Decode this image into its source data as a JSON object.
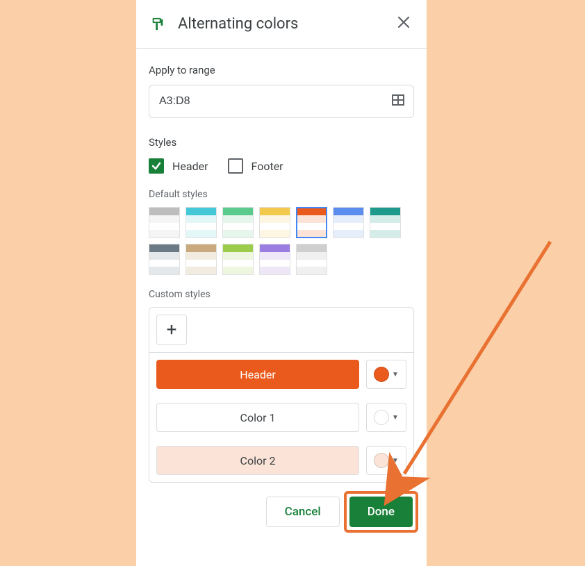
{
  "panel": {
    "title": "Alternating colors"
  },
  "range": {
    "label": "Apply to range",
    "value": "A3:D8"
  },
  "styles": {
    "label": "Styles",
    "header_label": "Header",
    "footer_label": "Footer",
    "header_checked": true,
    "footer_checked": false
  },
  "default_styles": {
    "label": "Default styles",
    "selected_index": 4,
    "swatches": [
      {
        "head": "#bdbdbd",
        "r1": "#f5f5f5",
        "r2": "#ffffff",
        "r3": "#f5f5f5"
      },
      {
        "head": "#44c8d7",
        "r1": "#e3f6f8",
        "r2": "#ffffff",
        "r3": "#e3f6f8"
      },
      {
        "head": "#5bca8d",
        "r1": "#e6f6ed",
        "r2": "#ffffff",
        "r3": "#e6f6ed"
      },
      {
        "head": "#f2c94c",
        "r1": "#fdf6e2",
        "r2": "#ffffff",
        "r3": "#fdf6e2"
      },
      {
        "head": "#ea5a1c",
        "r1": "#fbe4d7",
        "r2": "#ffffff",
        "r3": "#fbe4d7"
      },
      {
        "head": "#5b8def",
        "r1": "#e6edfb",
        "r2": "#ffffff",
        "r3": "#e6edfb"
      },
      {
        "head": "#1d9a8c",
        "r1": "#d4ede9",
        "r2": "#ffffff",
        "r3": "#d4ede9"
      },
      {
        "head": "#6b7a85",
        "r1": "#e4e8eb",
        "r2": "#ffffff",
        "r3": "#e4e8eb"
      },
      {
        "head": "#c9a97d",
        "r1": "#f2ebdf",
        "r2": "#ffffff",
        "r3": "#f2ebdf"
      },
      {
        "head": "#9ccc4c",
        "r1": "#eef6df",
        "r2": "#ffffff",
        "r3": "#eef6df"
      },
      {
        "head": "#9a7de0",
        "r1": "#ede7f8",
        "r2": "#ffffff",
        "r3": "#ede7f8"
      },
      {
        "head": "#cfcfcf",
        "r1": "#f0f0f0",
        "r2": "#ffffff",
        "r3": "#f0f0f0"
      }
    ]
  },
  "custom_styles": {
    "label": "Custom styles",
    "rows": [
      {
        "label": "Header",
        "color": "#ea5a1c",
        "is_header": true
      },
      {
        "label": "Color 1",
        "color": "#ffffff",
        "is_header": false
      },
      {
        "label": "Color 2",
        "color": "#fbe4d7",
        "is_header": false
      }
    ]
  },
  "buttons": {
    "cancel": "Cancel",
    "done": "Done"
  },
  "annotation": {
    "highlight_target": "done-button",
    "arrow_color": "#e97132"
  }
}
